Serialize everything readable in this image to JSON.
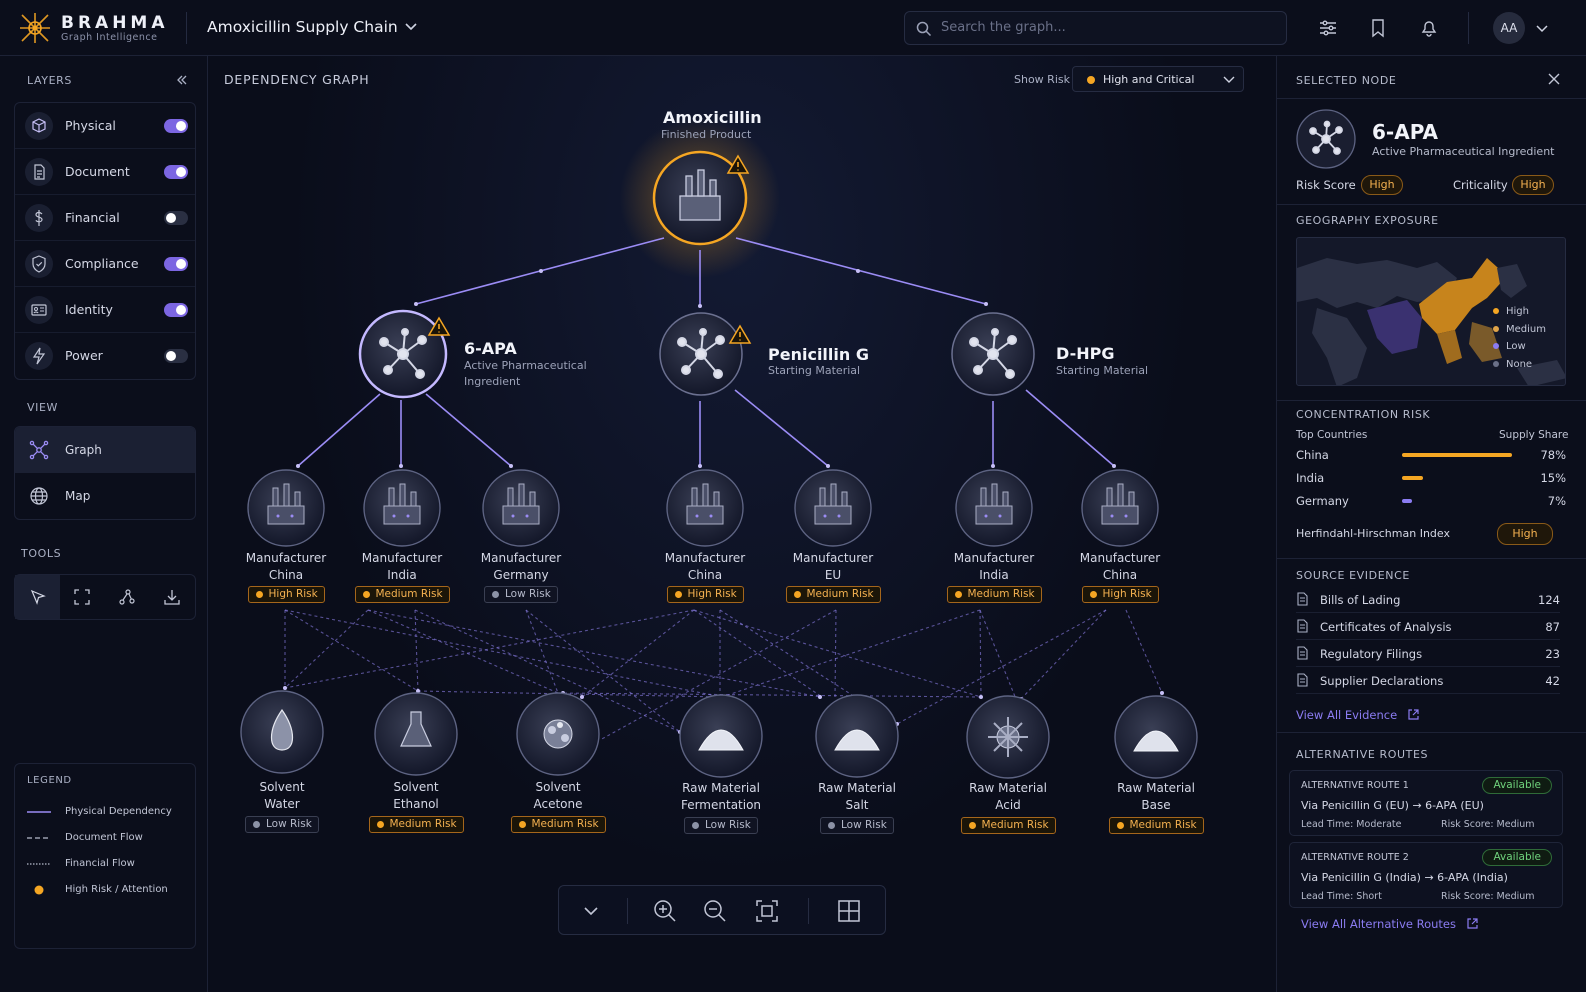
{
  "app": {
    "brand": "BRAHMA",
    "brand_sub": "Graph Intelligence",
    "project": "Amoxicillin Supply Chain",
    "search_placeholder": "Search the graph...",
    "avatar": "AA"
  },
  "left": {
    "layers_title": "LAYERS",
    "layers": [
      {
        "label": "Physical",
        "icon": "cube-icon",
        "on": true
      },
      {
        "label": "Document",
        "icon": "document-icon",
        "on": true
      },
      {
        "label": "Financial",
        "icon": "dollar-icon",
        "on": false
      },
      {
        "label": "Compliance",
        "icon": "shield-icon",
        "on": true
      },
      {
        "label": "Identity",
        "icon": "id-card-icon",
        "on": true
      },
      {
        "label": "Power",
        "icon": "lightning-icon",
        "on": false
      }
    ],
    "view_title": "VIEW",
    "views": [
      {
        "label": "Graph",
        "active": true
      },
      {
        "label": "Map",
        "active": false
      }
    ],
    "tools_title": "TOOLS",
    "legend_title": "LEGEND",
    "legend": [
      "Physical Dependency",
      "Document Flow",
      "Financial Flow",
      "High Risk / Attention"
    ]
  },
  "main": {
    "title": "DEPENDENCY GRAPH",
    "show_risk": "Show Risk",
    "risk_filter": "High and Critical",
    "root": {
      "name": "Amoxicillin",
      "sub": "Finished Product"
    },
    "tier1": [
      {
        "name": "6-APA",
        "sub1": "Active Pharmaceutical",
        "sub2": "Ingredient"
      },
      {
        "name": "Penicillin G",
        "sub1": "Starting Material",
        "sub2": ""
      },
      {
        "name": "D-HPG",
        "sub1": "Starting Material",
        "sub2": ""
      }
    ],
    "manufacturers": [
      {
        "l1": "Manufacturer",
        "l2": "China",
        "risk": "High Risk",
        "level": "high"
      },
      {
        "l1": "Manufacturer",
        "l2": "India",
        "risk": "Medium Risk",
        "level": "medium"
      },
      {
        "l1": "Manufacturer",
        "l2": "Germany",
        "risk": "Low Risk",
        "level": "low"
      },
      {
        "l1": "Manufacturer",
        "l2": "China",
        "risk": "High Risk",
        "level": "high"
      },
      {
        "l1": "Manufacturer",
        "l2": "EU",
        "risk": "Medium Risk",
        "level": "medium"
      },
      {
        "l1": "Manufacturer",
        "l2": "India",
        "risk": "Medium Risk",
        "level": "medium"
      },
      {
        "l1": "Manufacturer",
        "l2": "China",
        "risk": "High Risk",
        "level": "high"
      }
    ],
    "materials": [
      {
        "l1": "Solvent",
        "l2": "Water",
        "risk": "Low Risk",
        "level": "low"
      },
      {
        "l1": "Solvent",
        "l2": "Ethanol",
        "risk": "Medium Risk",
        "level": "medium"
      },
      {
        "l1": "Solvent",
        "l2": "Acetone",
        "risk": "Medium Risk",
        "level": "medium"
      },
      {
        "l1": "Raw Material",
        "l2": "Fermentation",
        "risk": "Low Risk",
        "level": "low"
      },
      {
        "l1": "Raw Material",
        "l2": "Salt",
        "risk": "Low Risk",
        "level": "low"
      },
      {
        "l1": "Raw Material",
        "l2": "Acid",
        "risk": "Medium Risk",
        "level": "medium"
      },
      {
        "l1": "Raw Material",
        "l2": "Base",
        "risk": "Medium Risk",
        "level": "medium"
      }
    ]
  },
  "right": {
    "title": "SELECTED NODE",
    "node_name": "6-APA",
    "node_sub": "Active Pharmaceutical Ingredient",
    "risk_score_label": "Risk Score",
    "risk_score": "High",
    "criticality_label": "Criticality",
    "criticality": "High",
    "geo_title": "GEOGRAPHY EXPOSURE",
    "geo_legend": [
      "High",
      "Medium",
      "Low",
      "None"
    ],
    "conc_title": "CONCENTRATION RISK",
    "top_countries": "Top Countries",
    "supply_share": "Supply Share",
    "countries": [
      {
        "name": "China",
        "share": "78%",
        "value": 78,
        "color": "#f5a623"
      },
      {
        "name": "India",
        "share": "15%",
        "value": 15,
        "color": "#f5a623"
      },
      {
        "name": "Germany",
        "share": "7%",
        "value": 7,
        "color": "#8b7cf2"
      }
    ],
    "hhi_label": "Herfindahl-Hirschman Index",
    "hhi": "High",
    "evidence_title": "SOURCE EVIDENCE",
    "evidence": [
      {
        "label": "Bills of Lading",
        "count": "124"
      },
      {
        "label": "Certificates of Analysis",
        "count": "87"
      },
      {
        "label": "Regulatory Filings",
        "count": "23"
      },
      {
        "label": "Supplier Declarations",
        "count": "42"
      }
    ],
    "view_evidence": "View All Evidence",
    "alt_title": "ALTERNATIVE ROUTES",
    "routes": [
      {
        "title": "ALTERNATIVE ROUTE 1",
        "status": "Available",
        "path": "Via Penicillin G (EU) → 6-APA (EU)",
        "lead": "Lead Time: Moderate",
        "risk": "Risk Score: Medium"
      },
      {
        "title": "ALTERNATIVE ROUTE 2",
        "status": "Available",
        "path": "Via Penicillin G (India) → 6-APA (India)",
        "lead": "Lead Time: Short",
        "risk": "Risk Score: Medium"
      }
    ],
    "view_routes": "View All Alternative Routes"
  }
}
